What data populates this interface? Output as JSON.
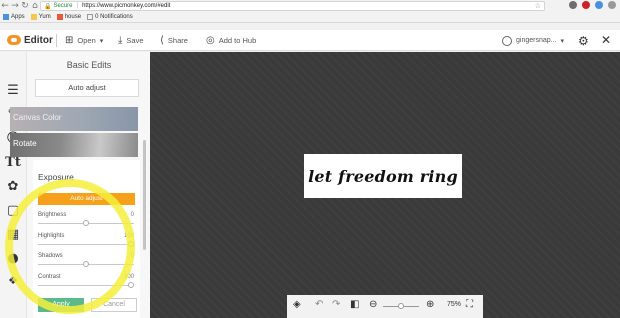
{
  "browser": {
    "secure_label": "Secure",
    "url_prefix": "https://",
    "url": "www.picmonkey.com/#edit",
    "bookmarks": [
      "Apps",
      "Yum",
      "house",
      "0 Notifications"
    ]
  },
  "toolbar": {
    "app_name": "Editor",
    "open_label": "Open",
    "save_label": "Save",
    "share_label": "Share",
    "hub_label": "Add to Hub",
    "user_label": "gingersnap..."
  },
  "panel": {
    "title": "Basic Edits",
    "auto_adjust_label": "Auto adjust",
    "tiles": [
      "Canvas Color",
      "Rotate"
    ],
    "exposure": {
      "title": "Exposure",
      "auto_label": "Auto adjust",
      "sliders": [
        {
          "label": "Brightness",
          "value": "0",
          "level": 0.5
        },
        {
          "label": "Highlights",
          "value": "100",
          "level": 1.0
        },
        {
          "label": "Shadows",
          "value": "0",
          "level": 0.5
        },
        {
          "label": "Contrast",
          "value": "100",
          "level": 1.0
        }
      ]
    },
    "apply_label": "Apply",
    "cancel_label": "Cancel"
  },
  "canvas": {
    "artwork_text": "let freedom ring",
    "zoom": "75%",
    "zoom_level": 0.5
  },
  "colors": {
    "accent_orange": "#f7a11a",
    "apply_green": "#5bb98a",
    "highlight_yellow": "#f5ef3c",
    "canvas_bg": "#3a3a3a"
  },
  "icons": {
    "rail": [
      "sliders-icon",
      "magic-wand-icon",
      "face-icon",
      "text-icon",
      "butterfly-icon",
      "frame-icon",
      "texture-icon",
      "apple-icon",
      "themes-icon"
    ],
    "bottom": [
      "layers-icon",
      "undo-icon",
      "redo-icon",
      "compare-icon",
      "zoom-out-icon",
      "zoom-in-icon",
      "fullscreen-icon"
    ]
  }
}
